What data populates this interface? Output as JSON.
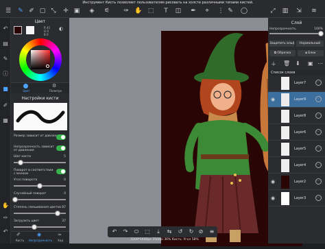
{
  "tooltip": "Инструмент Кисть позволяет пользователям рисовать на холсте различными типами кистей.",
  "toolbar_icons": [
    "menu-icon",
    "brush-icon",
    "eraser-icon",
    "select-rect-icon",
    "transform-icon",
    "move-icon",
    "fill-icon",
    "magic-wand-icon",
    "paint-bucket-icon",
    "eyedropper-icon",
    "text-icon",
    "ruler-icon",
    "layers-view-icon",
    "resize-icon"
  ],
  "left": {
    "color_title": "Цвет",
    "color_values": [
      "R 41",
      "G 0",
      "B 0"
    ],
    "brush_settings_title": "Настройки кисти",
    "tab_color": "Цвет",
    "tab_palette": "Палитра",
    "settings": [
      {
        "label": "Размер зависит от давления",
        "type": "toggle",
        "on": true
      },
      {
        "label": "Непрозрачность зависит от давления",
        "type": "toggle",
        "on": true
      },
      {
        "label": "Шаг кисти",
        "type": "slider",
        "value": "5"
      },
      {
        "label": "Поворот в соответствии с мазком",
        "type": "toggle",
        "on": true
      },
      {
        "label": "Угол поворота",
        "type": "slider",
        "value": "0"
      },
      {
        "label": "Случайный поворот",
        "type": "slider",
        "value": "0"
      },
      {
        "label": "Степень смешивания цветов",
        "type": "slider",
        "value": "87"
      },
      {
        "label": "Загрузить цвет",
        "type": "slider",
        "value": "37"
      }
    ],
    "bottom_tabs": [
      "Кисть",
      "Непрозрачность",
      "Ход"
    ],
    "brush_size_value": "2",
    "bottom_slider_value": "0"
  },
  "right": {
    "title": "Слой",
    "opacity_label": "Непрозрачность",
    "opacity_value": "100%",
    "blend_left": "Защитить альфа слоя",
    "blend_right": "Нормальный",
    "btn_clip": "Обрезка",
    "btn_lock": "Блок",
    "layer_list_title": "Список слоев",
    "layers": [
      {
        "name": "Layer7",
        "visible": false,
        "thumb": "#f1f1f1",
        "selected": false
      },
      {
        "name": "Layer9",
        "visible": true,
        "thumb": "#ececec",
        "selected": true
      },
      {
        "name": "Layer8",
        "visible": false,
        "thumb": "#f1f1f1",
        "selected": false
      },
      {
        "name": "Layer6",
        "visible": false,
        "thumb": "#eeeeee",
        "selected": false
      },
      {
        "name": "Layer5",
        "visible": false,
        "thumb": "#f1f1f1",
        "selected": false
      },
      {
        "name": "Layer4",
        "visible": false,
        "thumb": "#eeeeee",
        "selected": false
      },
      {
        "name": "Layer2",
        "visible": true,
        "thumb": "#2a0506",
        "selected": false
      },
      {
        "name": "Layer3",
        "visible": true,
        "thumb": "#ffffff",
        "selected": false
      }
    ]
  },
  "status_text": "3200*1640px 350dpi 36% Кисть: Угол 58%",
  "colors": {
    "accent": "#4aa3ff",
    "artboard": "#2a0506",
    "toggle_on": "#37b24d",
    "selected_layer": "#3c6e9e"
  }
}
